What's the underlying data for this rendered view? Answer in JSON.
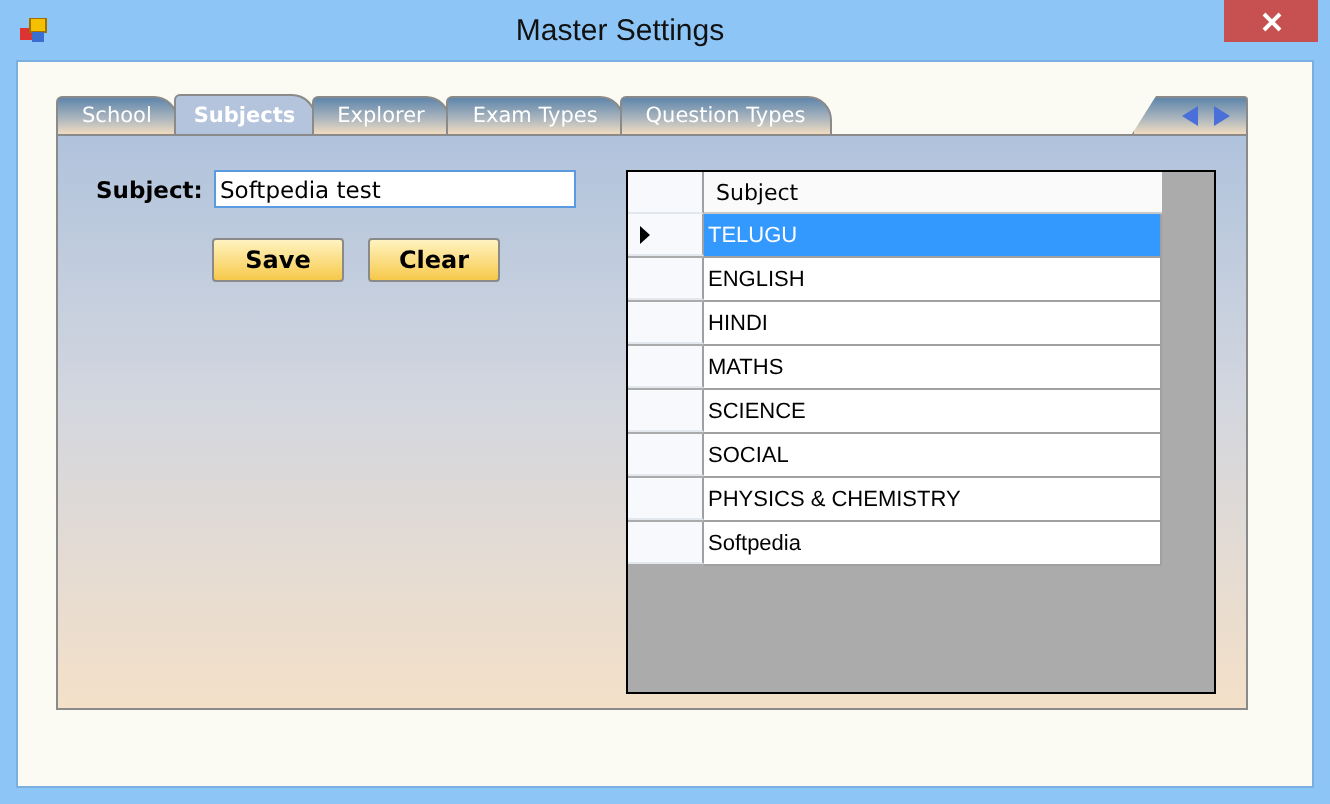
{
  "window": {
    "title": "Master Settings"
  },
  "tabs": [
    {
      "label": "School",
      "selected": false
    },
    {
      "label": "Subjects",
      "selected": true
    },
    {
      "label": "Explorer",
      "selected": false
    },
    {
      "label": "Exam Types",
      "selected": false
    },
    {
      "label": "Question Types",
      "selected": false
    }
  ],
  "form": {
    "label": "Subject:",
    "value": "Softpedia test",
    "buttons": [
      "Save",
      "Clear"
    ]
  },
  "grid": {
    "columns": [
      "Subject"
    ],
    "rows": [
      {
        "cell": "TELUGU",
        "selected": true
      },
      {
        "cell": "ENGLISH",
        "selected": false
      },
      {
        "cell": "HINDI",
        "selected": false
      },
      {
        "cell": "MATHS",
        "selected": false
      },
      {
        "cell": "SCIENCE",
        "selected": false
      },
      {
        "cell": "SOCIAL",
        "selected": false
      },
      {
        "cell": "PHYSICS & CHEMISTRY",
        "selected": false
      },
      {
        "cell": "Softpedia",
        "selected": false
      }
    ]
  }
}
